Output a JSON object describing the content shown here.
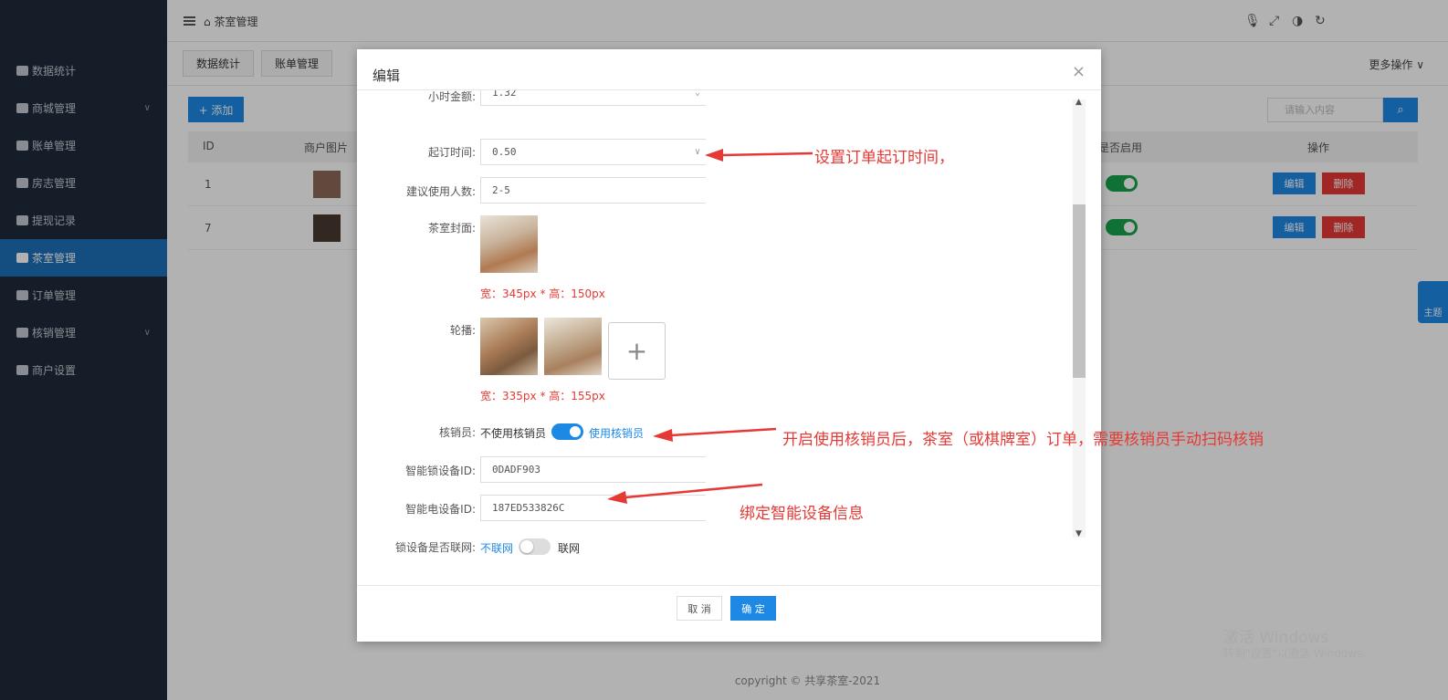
{
  "sidebar": {
    "items": [
      {
        "label": "数据统计",
        "icon": "dashboard-icon"
      },
      {
        "label": "商城管理",
        "icon": "shop-icon",
        "has_arrow": true
      },
      {
        "label": "账单管理",
        "icon": "bill-icon"
      },
      {
        "label": "房志管理",
        "icon": "room-icon"
      },
      {
        "label": "提现记录",
        "icon": "cash-icon"
      },
      {
        "label": "茶室管理",
        "icon": "teahouse-icon",
        "active": true
      },
      {
        "label": "订单管理",
        "icon": "order-icon"
      },
      {
        "label": "核销管理",
        "icon": "user-icon",
        "has_arrow": true
      },
      {
        "label": "商户设置",
        "icon": "gear-icon"
      }
    ]
  },
  "topbar": {
    "breadcrumb": "茶室管理",
    "more_ops": "更多操作"
  },
  "tabs": [
    {
      "label": "数据统计"
    },
    {
      "label": "账单管理"
    }
  ],
  "content": {
    "add_label": "+ 添加",
    "search_placeholder": "请输入内容",
    "columns": {
      "id": "ID",
      "image": "商户图片",
      "enabled": "是否启用",
      "actions": "操作"
    },
    "rows": [
      {
        "id": "1",
        "enabled": true
      },
      {
        "id": "7",
        "enabled": true
      }
    ],
    "edit_label": "编辑",
    "delete_label": "删除",
    "footer": "copyright © 共享茶室-2021",
    "theme_tab": "主题"
  },
  "modal": {
    "title": "编辑",
    "close": "×",
    "fields": {
      "hour_price_label": "小时金额:",
      "hour_price_value": "1.32",
      "start_time_label": "起订时间:",
      "start_time_value": "0.50",
      "people_label": "建议使用人数:",
      "people_value": "2-5",
      "cover_label": "茶室封面:",
      "cover_tip": "宽：345px * 高：150px",
      "carousel_label": "轮播:",
      "carousel_tip": "宽：335px * 高：155px",
      "verifier_label": "核销员:",
      "verifier_off": "不使用核销员",
      "verifier_on": "使用核销员",
      "lock_label": "智能锁设备ID:",
      "lock_value": "0DADF903",
      "power_label": "智能电设备ID:",
      "power_value": "187ED533826C",
      "network_label": "锁设备是否联网:",
      "network_off": "不联网",
      "network_on": "联网"
    },
    "cancel_label": "取 消",
    "ok_label": "确 定"
  },
  "annotations": {
    "a1": "设置订单起订时间，",
    "a2": "开启使用核销员后，茶室（或棋牌室）订单，需要核销员手动扫码核销",
    "a3": "绑定智能设备信息"
  },
  "watermark": {
    "line1": "激活 Windows",
    "line2": "转到\"设置\"以激活 Windows。"
  },
  "colors": {
    "sidebar_bg": "#1f2a3a",
    "accent": "#1e88e5",
    "danger": "#e53935",
    "success": "#16a34a"
  }
}
